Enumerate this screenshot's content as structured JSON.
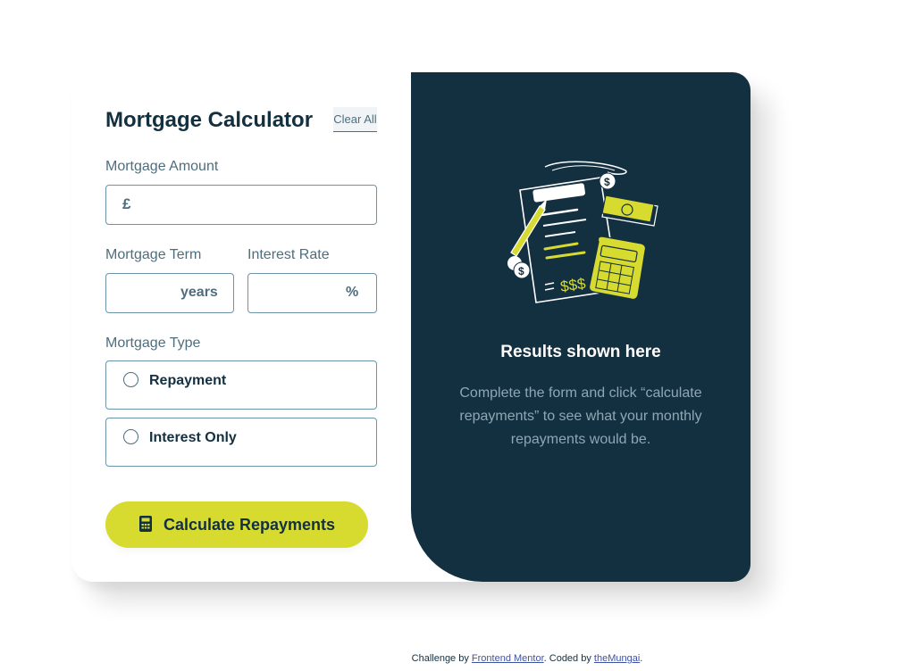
{
  "form": {
    "title": "Mortgage Calculator",
    "clear_label": "Clear All",
    "amount": {
      "label": "Mortgage Amount",
      "prefix": "£",
      "value": ""
    },
    "term": {
      "label": "Mortgage Term",
      "suffix": "years",
      "value": ""
    },
    "rate": {
      "label": "Interest Rate",
      "suffix": "%",
      "value": ""
    },
    "type": {
      "label": "Mortgage Type",
      "options": [
        {
          "label": "Repayment",
          "selected": false
        },
        {
          "label": "Interest Only",
          "selected": false
        }
      ]
    },
    "submit_label": "Calculate Repayments"
  },
  "results": {
    "title": "Results shown here",
    "text": "Complete the form and click “calculate repayments” to see what your monthly repayments would be.",
    "illustration_icon": "calculator-document-illustration",
    "dollar_text": "$$$"
  },
  "footer": {
    "prefix": "Challenge by ",
    "link1": "Frontend Mentor",
    "middle": ". Coded by ",
    "link2": "theMungai",
    "suffix": "."
  },
  "colors": {
    "accent": "#d8db2f",
    "dark": "#133041",
    "slate": "#4e6e7e",
    "border": "#6b94a8"
  }
}
